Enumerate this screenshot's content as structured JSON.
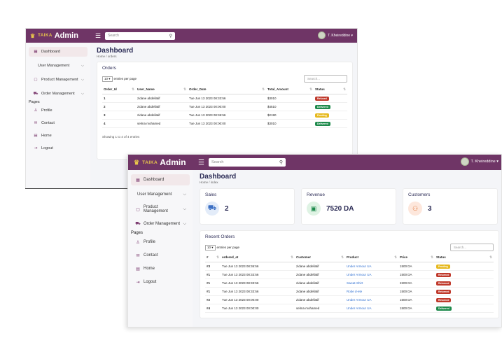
{
  "colors": {
    "topbar": "#6f3566",
    "accent": "#e9c64b",
    "sidebar_icon": "#7c3c70",
    "red": "#c0392b",
    "green": "#1e8a4c",
    "yellow": "#e6b91e"
  },
  "back": {
    "brand_sub": "TAIKA",
    "brand_main": "Admin",
    "search_placeholder": "Search",
    "user_name": "T. Kheireddine ▾",
    "sidebar": {
      "dashboard": "Dashboard",
      "user_mgmt": "User Management",
      "product_mgmt": "Product Management",
      "order_mgmt": "Order Management",
      "pages_heading": "Pages",
      "profile": "Profile",
      "contact": "Contact",
      "home": "Home",
      "logout": "Logout"
    },
    "page_title": "Dashboard",
    "breadcrumb": "Home / orders",
    "card_title": "Orders",
    "entries_value": "10 ▾",
    "entries_label": "entries per page",
    "search_placeholder2": "Search...",
    "columns": [
      "Order_Id",
      "User_Name",
      "Order_Date",
      "Total_Amount",
      "Status"
    ],
    "rows": [
      {
        "id": "1",
        "user": "zidane abdellatif",
        "date": "Tue Jun 13 2023 08:33:56",
        "total": "$3010",
        "status": "Refused",
        "tone": "red"
      },
      {
        "id": "2",
        "user": "zidane abdellatif",
        "date": "Tue Jun 13 2023 00:00:00",
        "total": "$4510",
        "status": "Delivered",
        "tone": "green"
      },
      {
        "id": "3",
        "user": "zidane abdellatif",
        "date": "Tue Jun 13 2023 08:36:56",
        "total": "$2190",
        "status": "Pending",
        "tone": "yellow"
      },
      {
        "id": "4",
        "user": "selma mohamed",
        "date": "Tue Jun 13 2023 00:00:00",
        "total": "$3010",
        "status": "Delivered",
        "tone": "green"
      }
    ],
    "footer": "Showing 1 to 4 of 4 entries"
  },
  "front": {
    "brand_sub": "TAIKA",
    "brand_main": "Admin",
    "search_placeholder": "Search",
    "user_name": "T. Kheireddine ▾",
    "sidebar": {
      "dashboard": "Dashboard",
      "user_mgmt": "User Management",
      "product_mgmt": "Product Management",
      "order_mgmt": "Order Management",
      "pages_heading": "Pages",
      "profile": "Profile",
      "contact": "Contact",
      "home": "Home",
      "logout": "Logout"
    },
    "page_title": "Dashboard",
    "breadcrumb": "Home / index",
    "stats": [
      {
        "label": "Sales",
        "value": "2",
        "icon": "cart-icon"
      },
      {
        "label": "Revenue",
        "value": "7520 DA",
        "icon": "money-icon"
      },
      {
        "label": "Customers",
        "value": "3",
        "icon": "people-icon"
      }
    ],
    "recent_title": "Recent Orders",
    "entries_value": "10 ▾",
    "entries_label": "entries per page",
    "search_placeholder2": "Search...",
    "columns": [
      "#",
      "ordered_at",
      "Customer",
      "Product",
      "Price",
      "Status"
    ],
    "rows": [
      {
        "num": "#3",
        "date": "Tue Jun 13 2023 08:36:56",
        "customer": "zidane abdellatif",
        "product": "Under Armour UA",
        "price": "1500 DA",
        "status": "Pending",
        "tone": "yellow"
      },
      {
        "num": "#1",
        "date": "Tue Jun 13 2023 08:33:56",
        "customer": "zidane abdellatif",
        "product": "Under Armour UA",
        "price": "1500 DA",
        "status": "Returned",
        "tone": "red"
      },
      {
        "num": "#1",
        "date": "Tue Jun 13 2023 08:33:56",
        "customer": "zidane abdellatif",
        "product": "Sweat-Shirt",
        "price": "2200 DA",
        "status": "Returned",
        "tone": "red"
      },
      {
        "num": "#1",
        "date": "Tue Jun 13 2023 08:33:56",
        "customer": "zidane abdellatif",
        "product": "Robe d-ete",
        "price": "1500 DA",
        "status": "Returned",
        "tone": "red"
      },
      {
        "num": "#2",
        "date": "Tue Jun 13 2023 00:00:00",
        "customer": "zidane abdellatif",
        "product": "Under Armour UA",
        "price": "1500 DA",
        "status": "Returned",
        "tone": "red"
      },
      {
        "num": "#4",
        "date": "Tue Jun 13 2023 00:00:00",
        "customer": "selma mohamed",
        "product": "Under Armour UA",
        "price": "1500 DA",
        "status": "Delivered",
        "tone": "green"
      }
    ]
  }
}
